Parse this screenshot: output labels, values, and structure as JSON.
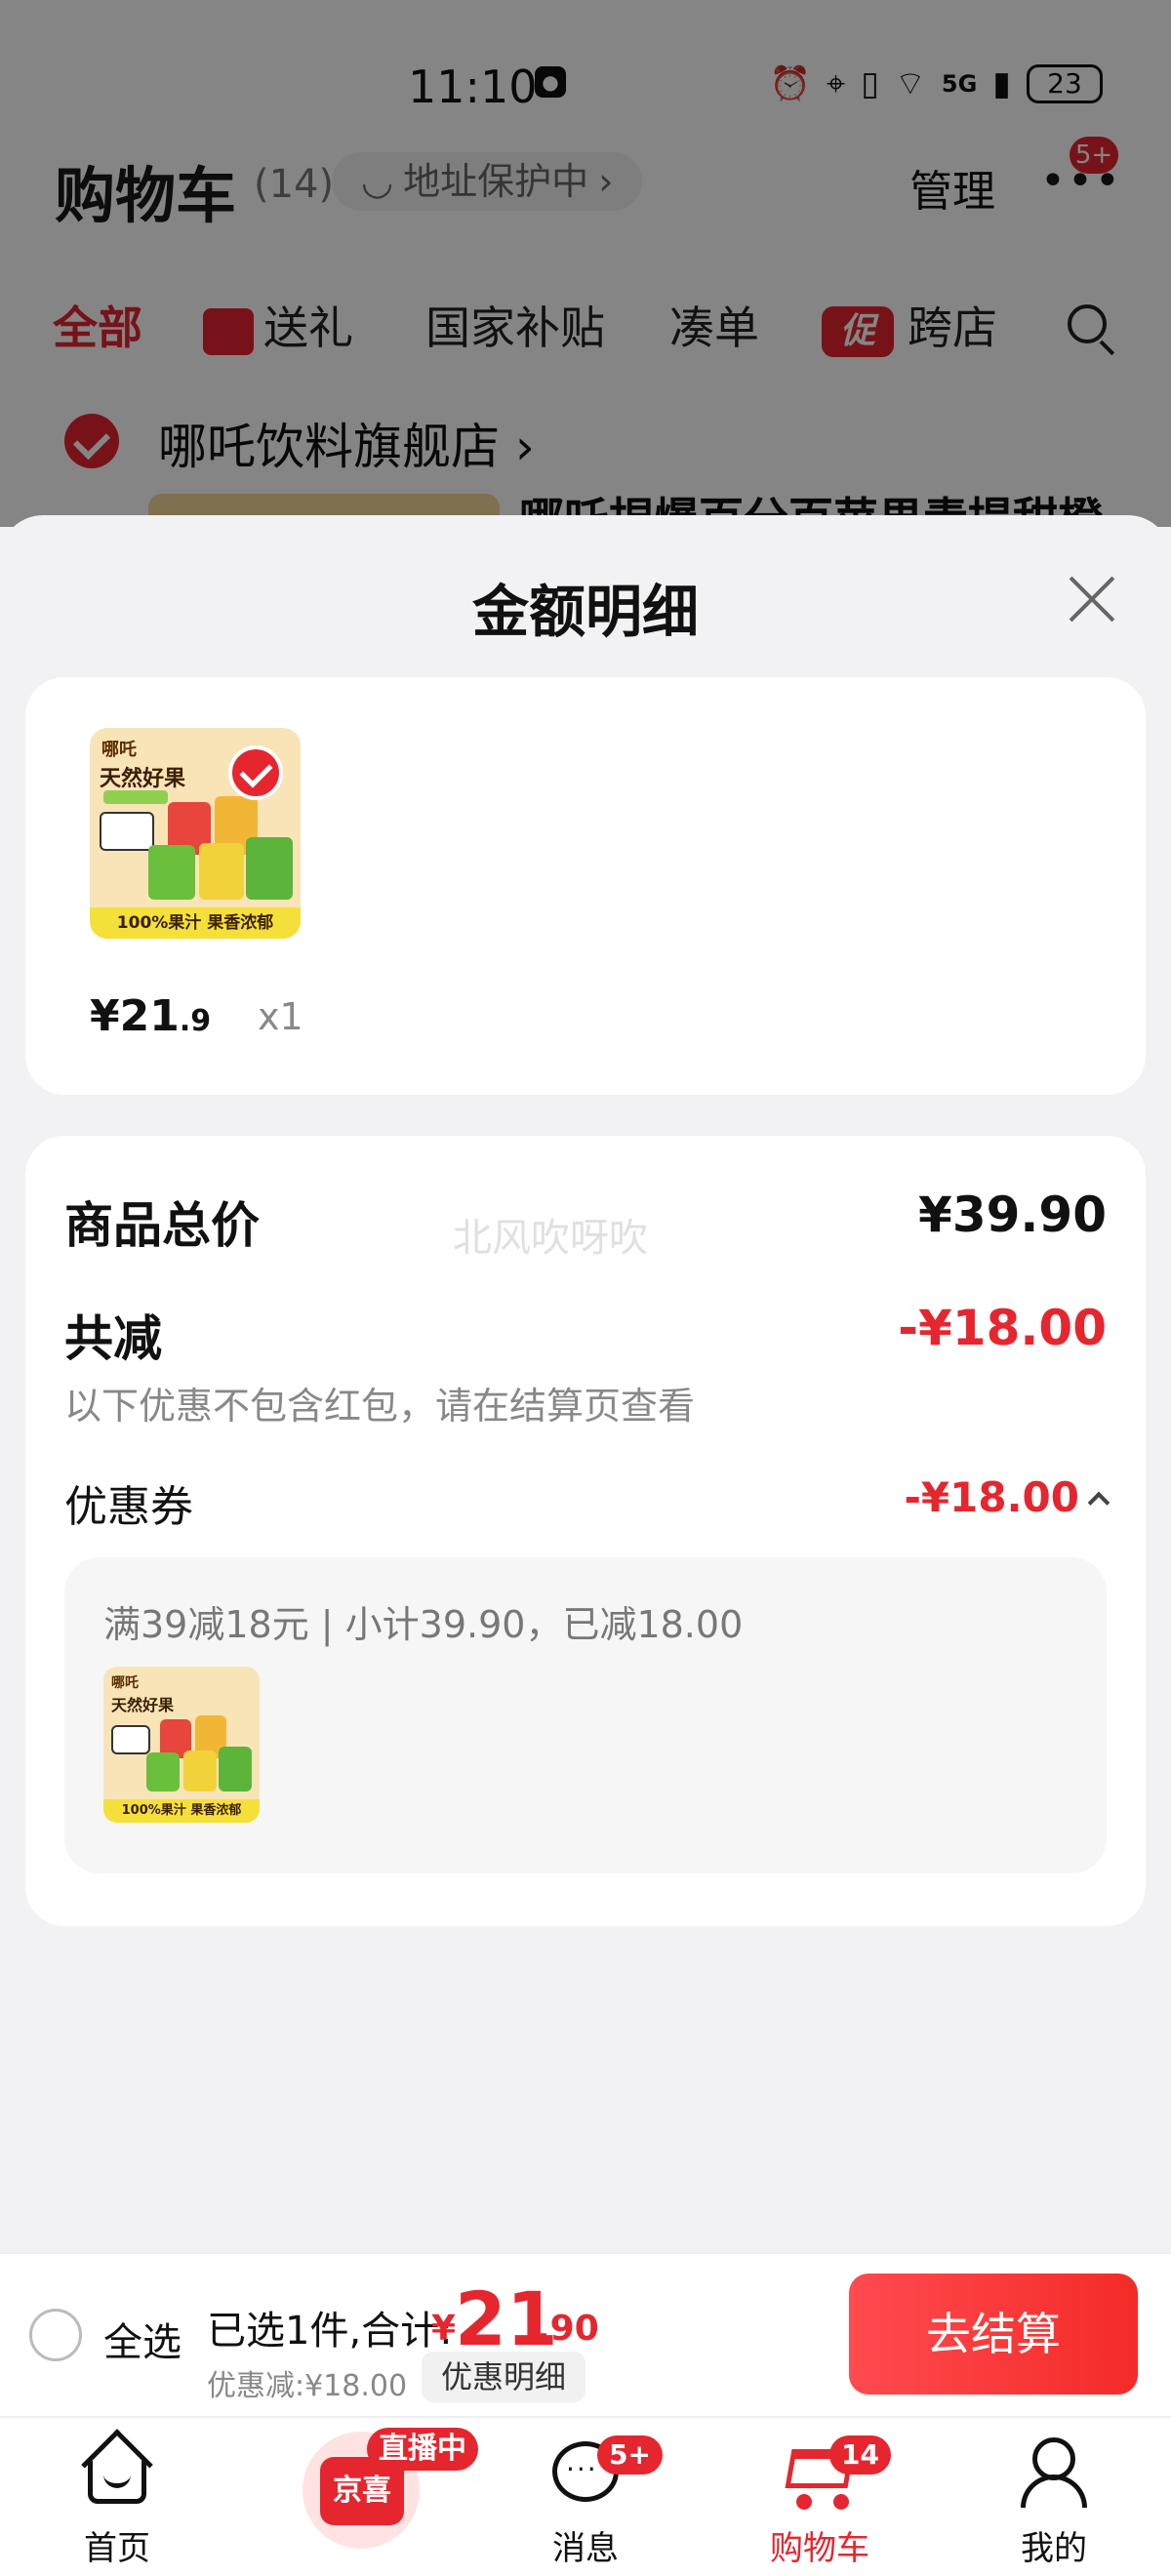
{
  "status_bar": {
    "time": "11:10",
    "network": "5G",
    "battery": "23"
  },
  "cart_header": {
    "title": "购物车",
    "count": "(14)",
    "address_status": "地址保护中",
    "manage": "管理",
    "more_badge": "5+"
  },
  "tabs": [
    {
      "label": "全部",
      "active": true
    },
    {
      "label": "送礼",
      "icon": "gift-icon"
    },
    {
      "label": "国家补贴"
    },
    {
      "label": "凑单"
    },
    {
      "label": "跨店",
      "badge": "促"
    }
  ],
  "shop": {
    "name": "哪吒饮料旗舰店",
    "peek_product_title": "哪吒捏爆百分百苹果青提甜橙"
  },
  "sheet": {
    "title": "金额明细",
    "product": {
      "brand": "哪吒",
      "image_title": "天然好果",
      "image_banner": "100%果汁 果香浓郁",
      "price_int": "¥21",
      "price_dec": ".9",
      "qty": "x1"
    },
    "watermark": "北风吹呀吹",
    "summary": {
      "total_label": "商品总价",
      "total_value": "¥39.90",
      "reduce_label": "共减",
      "reduce_value": "-¥18.00",
      "reduce_note": "以下优惠不包含红包，请在结算页查看",
      "coupon_label": "优惠券",
      "coupon_value": "-¥18.00",
      "coupon_desc": "满39减18元 | 小计39.90，已减18.00"
    }
  },
  "checkout": {
    "select_all": "全选",
    "selected_text": "已选1件,合计:",
    "total_yen": "¥",
    "total_int": "21",
    "total_dec": ".90",
    "discount": "优惠减:¥18.00",
    "detail_button": "优惠明细",
    "pay_button": "去结算"
  },
  "bottom_nav": [
    {
      "label": "首页",
      "icon": "home-icon"
    },
    {
      "label": "",
      "icon": "live-icon",
      "badge": "直播中",
      "box_text": "京喜"
    },
    {
      "label": "消息",
      "icon": "message-icon",
      "badge": "5+"
    },
    {
      "label": "购物车",
      "icon": "cart-icon",
      "badge": "14",
      "active": true
    },
    {
      "label": "我的",
      "icon": "profile-icon"
    }
  ],
  "colors": {
    "accent_red": "#e5262f",
    "sheet_bg": "#f2f2f4"
  }
}
